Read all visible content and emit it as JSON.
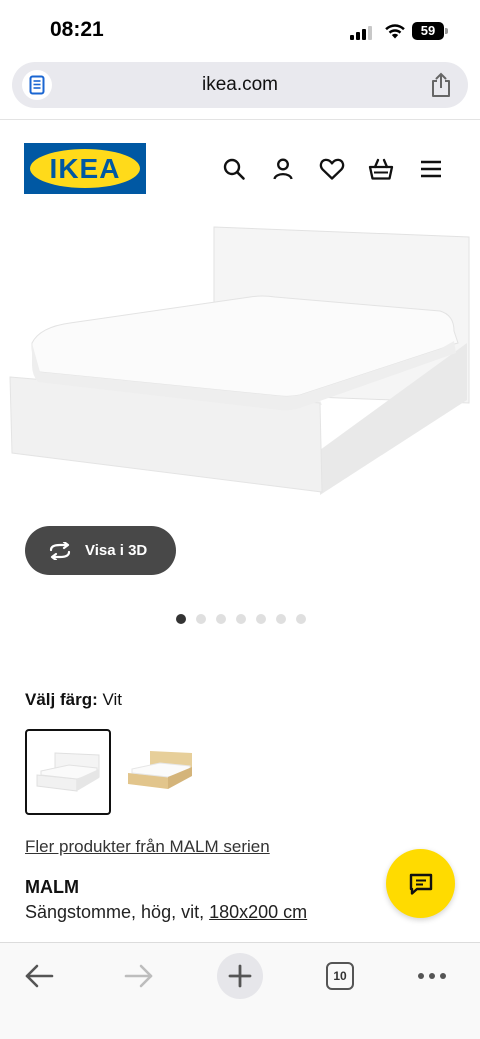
{
  "status_bar": {
    "time": "08:21",
    "battery": "59"
  },
  "browser": {
    "url": "ikea.com",
    "tab_count": "10"
  },
  "header": {
    "logo_text": "IKEA",
    "icons": [
      "search-icon",
      "account-icon",
      "heart-icon",
      "basket-icon",
      "menu-icon"
    ]
  },
  "product": {
    "view_3d_label": "Visa i 3D",
    "image_count": 7,
    "active_image": 1,
    "color_label": "Välj färg:",
    "color_value": "Vit",
    "color_options": [
      "Vit",
      "Ek"
    ],
    "series_link": "Fler produkter från MALM serien",
    "name": "MALM",
    "description": "Sängstomme, hög, vit,",
    "size": "180x200 cm"
  },
  "colors": {
    "ikea_blue": "#0058a3",
    "ikea_yellow": "#ffda1a",
    "chat_yellow": "#ffdb00",
    "button_dark": "#484848"
  }
}
